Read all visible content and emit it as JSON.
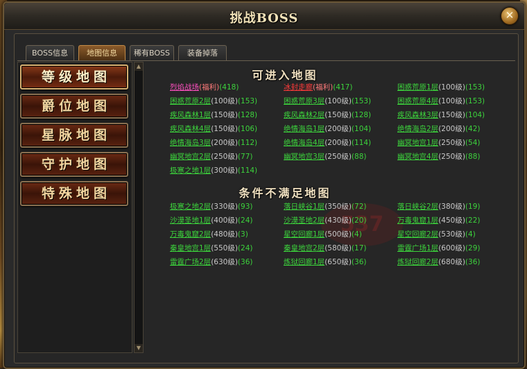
{
  "window": {
    "title": "挑战BOSS"
  },
  "tabs": [
    "BOSS信息",
    "地图信息",
    "稀有BOSS",
    "装备掉落"
  ],
  "active_tab": 1,
  "sidebar": [
    "等级地图",
    "爵位地图",
    "星脉地图",
    "守护地图",
    "特殊地图"
  ],
  "active_sidebar": 0,
  "sections": {
    "enterable": {
      "title": "可进入地图",
      "items": [
        {
          "name": "烈焰战场",
          "tag": "(福利)",
          "count": "(418)",
          "style": "pink"
        },
        {
          "name": "冰封走廊",
          "tag": "(福利)",
          "count": "(417)",
          "style": "red"
        },
        {
          "name": "困惑荒原1层",
          "req": "(100级)",
          "count": "(153)",
          "style": "green"
        },
        {
          "name": "困惑荒原2层",
          "req": "(100级)",
          "count": "(153)",
          "style": "green"
        },
        {
          "name": "困惑荒原3层",
          "req": "(100级)",
          "count": "(153)",
          "style": "green"
        },
        {
          "name": "困惑荒原4层",
          "req": "(100级)",
          "count": "(153)",
          "style": "green"
        },
        {
          "name": "疾风森林1层",
          "req": "(150级)",
          "count": "(128)",
          "style": "green"
        },
        {
          "name": "疾风森林2层",
          "req": "(150级)",
          "count": "(128)",
          "style": "green"
        },
        {
          "name": "疾风森林3层",
          "req": "(150级)",
          "count": "(104)",
          "style": "green"
        },
        {
          "name": "疾风森林4层",
          "req": "(150级)",
          "count": "(106)",
          "style": "green"
        },
        {
          "name": "绝情海岛1层",
          "req": "(200级)",
          "count": "(104)",
          "style": "green"
        },
        {
          "name": "绝情海岛2层",
          "req": "(200级)",
          "count": "(42)",
          "style": "green"
        },
        {
          "name": "绝情海岛3层",
          "req": "(200级)",
          "count": "(112)",
          "style": "green"
        },
        {
          "name": "绝情海岛4层",
          "req": "(200级)",
          "count": "(114)",
          "style": "green"
        },
        {
          "name": "幽冥地宫1层",
          "req": "(250级)",
          "count": "(54)",
          "style": "green"
        },
        {
          "name": "幽冥地宫2层",
          "req": "(250级)",
          "count": "(77)",
          "style": "green"
        },
        {
          "name": "幽冥地宫3层",
          "req": "(250级)",
          "count": "(88)",
          "style": "green"
        },
        {
          "name": "幽冥地宫4层",
          "req": "(250级)",
          "count": "(88)",
          "style": "green"
        },
        {
          "name": "极寒之地1层",
          "req": "(300级)",
          "count": "(114)",
          "style": "green"
        }
      ]
    },
    "locked": {
      "title": "条件不满足地图",
      "items": [
        {
          "name": "极寒之地2层",
          "req": "(330级)",
          "count": "(93)",
          "style": "green"
        },
        {
          "name": "落日峡谷1层",
          "req": "(350级)",
          "count": "(72)",
          "style": "green"
        },
        {
          "name": "落日峡谷2层",
          "req": "(380级)",
          "count": "(19)",
          "style": "green"
        },
        {
          "name": "沙漠圣地1层",
          "req": "(400级)",
          "count": "(24)",
          "style": "green"
        },
        {
          "name": "沙漠圣地2层",
          "req": "(430级)",
          "count": "(20)",
          "style": "green"
        },
        {
          "name": "万毒鬼窟1层",
          "req": "(450级)",
          "count": "(22)",
          "style": "green"
        },
        {
          "name": "万毒鬼窟2层",
          "req": "(480级)",
          "count": "(3)",
          "style": "green"
        },
        {
          "name": "星空回廊1层",
          "req": "(500级)",
          "count": "(4)",
          "style": "green"
        },
        {
          "name": "星空回廊2层",
          "req": "(530级)",
          "count": "(4)",
          "style": "green"
        },
        {
          "name": "秦皇地宫1层",
          "req": "(550级)",
          "count": "(24)",
          "style": "green"
        },
        {
          "name": "秦皇地宫2层",
          "req": "(580级)",
          "count": "(17)",
          "style": "green"
        },
        {
          "name": "雷霆广场1层",
          "req": "(600级)",
          "count": "(29)",
          "style": "green"
        },
        {
          "name": "雷霆广场2层",
          "req": "(630级)",
          "count": "(36)",
          "style": "green"
        },
        {
          "name": "炼狱回廊1层",
          "req": "(650级)",
          "count": "(36)",
          "style": "green"
        },
        {
          "name": "炼狱回廊2层",
          "req": "(680级)",
          "count": "(36)",
          "style": "green"
        }
      ]
    }
  },
  "icons": {
    "close": "close-icon",
    "scroll_up": "arrow-up-icon",
    "scroll_down": "arrow-down-icon"
  }
}
